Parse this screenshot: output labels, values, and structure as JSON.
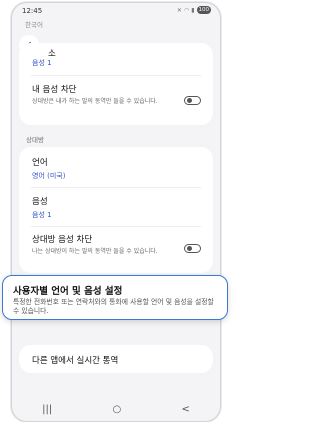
{
  "status": {
    "time": "12:45",
    "battery": "100"
  },
  "header": {
    "cutoff_text": "한국어"
  },
  "my_settings": {
    "voice_title_partial": "소",
    "voice_value": "음성 1",
    "block_title": "내 음성 차단",
    "block_desc": "상대방은 내가 하는 말의 동역만 들을 수 있습니다."
  },
  "other_party": {
    "section_label": "상대방",
    "language_title": "언어",
    "language_value": "영어 (미국)",
    "voice_title": "음성",
    "voice_value": "음성 1",
    "block_title": "상대방 음성 차단",
    "block_desc": "나는 상대방이 하는 말의 동역만 들을 수 있습니다."
  },
  "callout": {
    "title": "사용자별 언어 및 음성 설정",
    "desc": "특정한 전화번호 또는 연락처와의 통화에 사용할 언어 및 음성을 설정할 수 있습니다."
  },
  "other_apps": {
    "label": "다른 앱에서 실시간 통역"
  },
  "nav": {
    "recent": "|||",
    "home": "○",
    "back": "<"
  }
}
